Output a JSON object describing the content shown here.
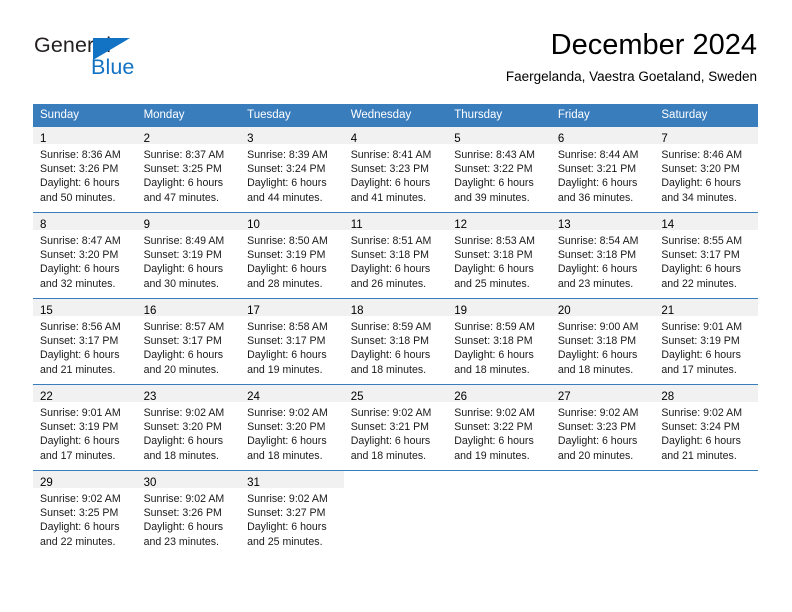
{
  "brand": {
    "name_part1": "General",
    "name_part2": "Blue",
    "logo_icon": "triangle-icon",
    "accent_color": "#1273c4"
  },
  "header": {
    "title": "December 2024",
    "subtitle": "Faergelanda, Vaestra Goetaland, Sweden"
  },
  "calendar": {
    "header_color": "#3a7dbd",
    "daynum_band_color": "#f1f1f1",
    "weekdays": [
      "Sunday",
      "Monday",
      "Tuesday",
      "Wednesday",
      "Thursday",
      "Friday",
      "Saturday"
    ],
    "weeks": [
      [
        {
          "day": "1",
          "sunrise": "Sunrise: 8:36 AM",
          "sunset": "Sunset: 3:26 PM",
          "daylight1": "Daylight: 6 hours",
          "daylight2": "and 50 minutes."
        },
        {
          "day": "2",
          "sunrise": "Sunrise: 8:37 AM",
          "sunset": "Sunset: 3:25 PM",
          "daylight1": "Daylight: 6 hours",
          "daylight2": "and 47 minutes."
        },
        {
          "day": "3",
          "sunrise": "Sunrise: 8:39 AM",
          "sunset": "Sunset: 3:24 PM",
          "daylight1": "Daylight: 6 hours",
          "daylight2": "and 44 minutes."
        },
        {
          "day": "4",
          "sunrise": "Sunrise: 8:41 AM",
          "sunset": "Sunset: 3:23 PM",
          "daylight1": "Daylight: 6 hours",
          "daylight2": "and 41 minutes."
        },
        {
          "day": "5",
          "sunrise": "Sunrise: 8:43 AM",
          "sunset": "Sunset: 3:22 PM",
          "daylight1": "Daylight: 6 hours",
          "daylight2": "and 39 minutes."
        },
        {
          "day": "6",
          "sunrise": "Sunrise: 8:44 AM",
          "sunset": "Sunset: 3:21 PM",
          "daylight1": "Daylight: 6 hours",
          "daylight2": "and 36 minutes."
        },
        {
          "day": "7",
          "sunrise": "Sunrise: 8:46 AM",
          "sunset": "Sunset: 3:20 PM",
          "daylight1": "Daylight: 6 hours",
          "daylight2": "and 34 minutes."
        }
      ],
      [
        {
          "day": "8",
          "sunrise": "Sunrise: 8:47 AM",
          "sunset": "Sunset: 3:20 PM",
          "daylight1": "Daylight: 6 hours",
          "daylight2": "and 32 minutes."
        },
        {
          "day": "9",
          "sunrise": "Sunrise: 8:49 AM",
          "sunset": "Sunset: 3:19 PM",
          "daylight1": "Daylight: 6 hours",
          "daylight2": "and 30 minutes."
        },
        {
          "day": "10",
          "sunrise": "Sunrise: 8:50 AM",
          "sunset": "Sunset: 3:19 PM",
          "daylight1": "Daylight: 6 hours",
          "daylight2": "and 28 minutes."
        },
        {
          "day": "11",
          "sunrise": "Sunrise: 8:51 AM",
          "sunset": "Sunset: 3:18 PM",
          "daylight1": "Daylight: 6 hours",
          "daylight2": "and 26 minutes."
        },
        {
          "day": "12",
          "sunrise": "Sunrise: 8:53 AM",
          "sunset": "Sunset: 3:18 PM",
          "daylight1": "Daylight: 6 hours",
          "daylight2": "and 25 minutes."
        },
        {
          "day": "13",
          "sunrise": "Sunrise: 8:54 AM",
          "sunset": "Sunset: 3:18 PM",
          "daylight1": "Daylight: 6 hours",
          "daylight2": "and 23 minutes."
        },
        {
          "day": "14",
          "sunrise": "Sunrise: 8:55 AM",
          "sunset": "Sunset: 3:17 PM",
          "daylight1": "Daylight: 6 hours",
          "daylight2": "and 22 minutes."
        }
      ],
      [
        {
          "day": "15",
          "sunrise": "Sunrise: 8:56 AM",
          "sunset": "Sunset: 3:17 PM",
          "daylight1": "Daylight: 6 hours",
          "daylight2": "and 21 minutes."
        },
        {
          "day": "16",
          "sunrise": "Sunrise: 8:57 AM",
          "sunset": "Sunset: 3:17 PM",
          "daylight1": "Daylight: 6 hours",
          "daylight2": "and 20 minutes."
        },
        {
          "day": "17",
          "sunrise": "Sunrise: 8:58 AM",
          "sunset": "Sunset: 3:17 PM",
          "daylight1": "Daylight: 6 hours",
          "daylight2": "and 19 minutes."
        },
        {
          "day": "18",
          "sunrise": "Sunrise: 8:59 AM",
          "sunset": "Sunset: 3:18 PM",
          "daylight1": "Daylight: 6 hours",
          "daylight2": "and 18 minutes."
        },
        {
          "day": "19",
          "sunrise": "Sunrise: 8:59 AM",
          "sunset": "Sunset: 3:18 PM",
          "daylight1": "Daylight: 6 hours",
          "daylight2": "and 18 minutes."
        },
        {
          "day": "20",
          "sunrise": "Sunrise: 9:00 AM",
          "sunset": "Sunset: 3:18 PM",
          "daylight1": "Daylight: 6 hours",
          "daylight2": "and 18 minutes."
        },
        {
          "day": "21",
          "sunrise": "Sunrise: 9:01 AM",
          "sunset": "Sunset: 3:19 PM",
          "daylight1": "Daylight: 6 hours",
          "daylight2": "and 17 minutes."
        }
      ],
      [
        {
          "day": "22",
          "sunrise": "Sunrise: 9:01 AM",
          "sunset": "Sunset: 3:19 PM",
          "daylight1": "Daylight: 6 hours",
          "daylight2": "and 17 minutes."
        },
        {
          "day": "23",
          "sunrise": "Sunrise: 9:02 AM",
          "sunset": "Sunset: 3:20 PM",
          "daylight1": "Daylight: 6 hours",
          "daylight2": "and 18 minutes."
        },
        {
          "day": "24",
          "sunrise": "Sunrise: 9:02 AM",
          "sunset": "Sunset: 3:20 PM",
          "daylight1": "Daylight: 6 hours",
          "daylight2": "and 18 minutes."
        },
        {
          "day": "25",
          "sunrise": "Sunrise: 9:02 AM",
          "sunset": "Sunset: 3:21 PM",
          "daylight1": "Daylight: 6 hours",
          "daylight2": "and 18 minutes."
        },
        {
          "day": "26",
          "sunrise": "Sunrise: 9:02 AM",
          "sunset": "Sunset: 3:22 PM",
          "daylight1": "Daylight: 6 hours",
          "daylight2": "and 19 minutes."
        },
        {
          "day": "27",
          "sunrise": "Sunrise: 9:02 AM",
          "sunset": "Sunset: 3:23 PM",
          "daylight1": "Daylight: 6 hours",
          "daylight2": "and 20 minutes."
        },
        {
          "day": "28",
          "sunrise": "Sunrise: 9:02 AM",
          "sunset": "Sunset: 3:24 PM",
          "daylight1": "Daylight: 6 hours",
          "daylight2": "and 21 minutes."
        }
      ],
      [
        {
          "day": "29",
          "sunrise": "Sunrise: 9:02 AM",
          "sunset": "Sunset: 3:25 PM",
          "daylight1": "Daylight: 6 hours",
          "daylight2": "and 22 minutes."
        },
        {
          "day": "30",
          "sunrise": "Sunrise: 9:02 AM",
          "sunset": "Sunset: 3:26 PM",
          "daylight1": "Daylight: 6 hours",
          "daylight2": "and 23 minutes."
        },
        {
          "day": "31",
          "sunrise": "Sunrise: 9:02 AM",
          "sunset": "Sunset: 3:27 PM",
          "daylight1": "Daylight: 6 hours",
          "daylight2": "and 25 minutes."
        },
        {
          "day": "",
          "sunrise": "",
          "sunset": "",
          "daylight1": "",
          "daylight2": ""
        },
        {
          "day": "",
          "sunrise": "",
          "sunset": "",
          "daylight1": "",
          "daylight2": ""
        },
        {
          "day": "",
          "sunrise": "",
          "sunset": "",
          "daylight1": "",
          "daylight2": ""
        },
        {
          "day": "",
          "sunrise": "",
          "sunset": "",
          "daylight1": "",
          "daylight2": ""
        }
      ]
    ]
  }
}
